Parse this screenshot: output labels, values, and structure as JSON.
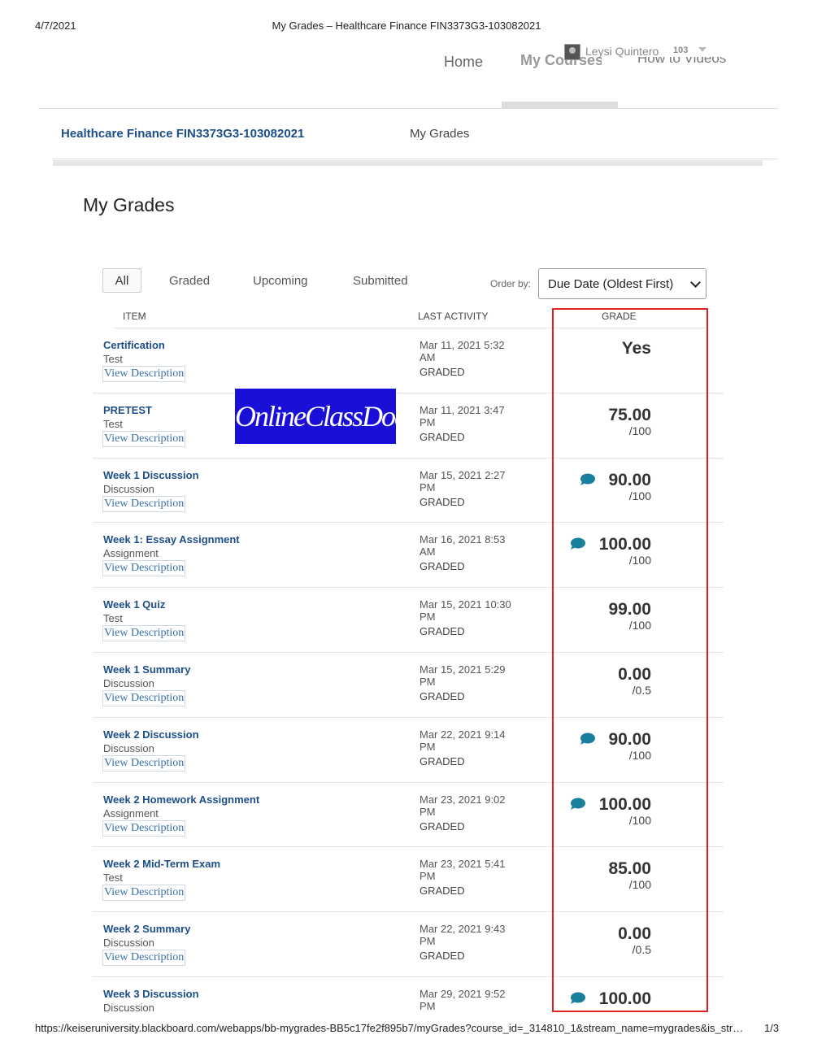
{
  "print_header": {
    "date": "4/7/2021",
    "title": "My Grades – Healthcare Finance FIN3373G3-103082021"
  },
  "nav": {
    "home": "Home",
    "my_courses": "My Courses",
    "how_to_videos": "How to Videos",
    "user_name": "Leysi Quintero",
    "user_count": "103"
  },
  "course": {
    "title": "Healthcare Finance FIN3373G3-103082021",
    "breadcrumb": "My Grades"
  },
  "page_title": "My Grades",
  "filters": {
    "all": "All",
    "graded": "Graded",
    "upcoming": "Upcoming",
    "submitted": "Submitted"
  },
  "order": {
    "label": "Order by:",
    "selected": "Due Date (Oldest First)"
  },
  "columns": {
    "item": "ITEM",
    "last_activity": "LAST ACTIVITY",
    "grade": "GRADE"
  },
  "link_text": "View Description",
  "watermark": "OnlineClassDoer",
  "rows": [
    {
      "name": "Certification",
      "type": "Test",
      "date1": "Mar 11, 2021 5:32",
      "date2": "AM",
      "status": "GRADED",
      "grade": "Yes",
      "max": ""
    },
    {
      "name": "PRETEST",
      "type": "Test",
      "date1": "Mar 11, 2021 3:47",
      "date2": "PM",
      "status": "GRADED",
      "grade": "75.00",
      "max": "/100"
    },
    {
      "name": "Week 1 Discussion",
      "type": "Discussion",
      "date1": "Mar 15, 2021 2:27",
      "date2": "PM",
      "status": "GRADED",
      "grade": "90.00",
      "max": "/100"
    },
    {
      "name": "Week 1: Essay Assignment",
      "type": "Assignment",
      "date1": "Mar 16, 2021 8:53",
      "date2": "AM",
      "status": "GRADED",
      "grade": "100.00",
      "max": "/100"
    },
    {
      "name": "Week 1 Quiz",
      "type": "Test",
      "date1": "Mar 15, 2021 10:30",
      "date2": "PM",
      "status": "GRADED",
      "grade": "99.00",
      "max": "/100"
    },
    {
      "name": "Week 1 Summary",
      "type": "Discussion",
      "date1": "Mar 15, 2021 5:29",
      "date2": "PM",
      "status": "GRADED",
      "grade": "0.00",
      "max": "/0.5"
    },
    {
      "name": "Week 2 Discussion",
      "type": "Discussion",
      "date1": "Mar 22, 2021 9:14",
      "date2": "PM",
      "status": "GRADED",
      "grade": "90.00",
      "max": "/100"
    },
    {
      "name": "Week 2 Homework Assignment",
      "type": "Assignment",
      "date1": "Mar 23, 2021 9:02",
      "date2": "PM",
      "status": "GRADED",
      "grade": "100.00",
      "max": "/100"
    },
    {
      "name": "Week 2 Mid-Term Exam",
      "type": "Test",
      "date1": "Mar 23, 2021 5:41",
      "date2": "PM",
      "status": "GRADED",
      "grade": "85.00",
      "max": "/100"
    },
    {
      "name": "Week 2 Summary",
      "type": "Discussion",
      "date1": "Mar 22, 2021 9:43",
      "date2": "PM",
      "status": "GRADED",
      "grade": "0.00",
      "max": "/0.5"
    },
    {
      "name": "Week 3 Discussion",
      "type": "Discussion",
      "date1": "Mar 29, 2021 9:52",
      "date2": "PM",
      "status": "",
      "grade": "100.00",
      "max": ""
    }
  ],
  "footer": {
    "url": "https://keiseruniversity.blackboard.com/webapps/bb-mygrades-BB5c17fe2f895b7/myGrades?course_id=_314810_1&stream_name=mygrades&is_str…",
    "page": "1/3"
  },
  "colors": {
    "link": "#1d4e89",
    "highlight_box": "#e02020",
    "feedback_icon": "#1a7f9c",
    "watermark_bg": "#1a0fd6"
  },
  "icons": [
    "user-avatar-icon",
    "chevron-down-icon",
    "feedback-comment-icon"
  ]
}
